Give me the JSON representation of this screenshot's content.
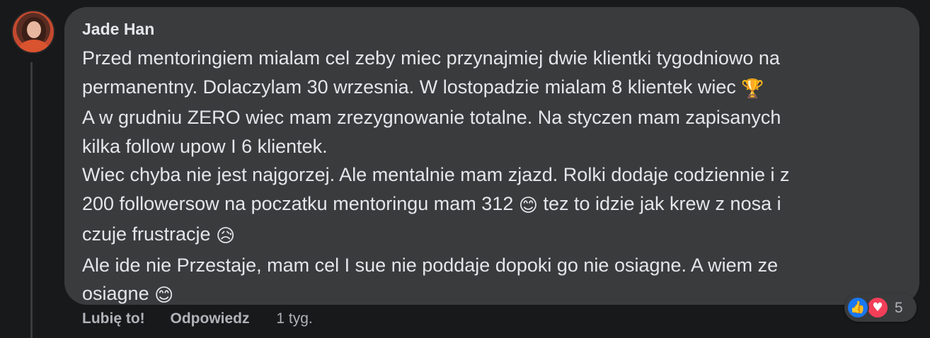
{
  "comment": {
    "author": "Jade Han",
    "lines": [
      {
        "text": "Przed mentoringiem mialam cel zeby miec przynajmiej dwie klientki tygodniowo na",
        "emoji": ""
      },
      {
        "text": "permanentny. Dolaczylam 30 wrzesnia. W lostopadzie mialam 8 klientek wiec ",
        "emoji": "🏆"
      },
      {
        "text": "A w grudniu ZERO wiec mam zrezygnowanie totalne. Na styczen mam zapisanych",
        "emoji": ""
      },
      {
        "text": "kilka follow upow I 6 klientek.",
        "emoji": ""
      },
      {
        "text": "Wiec chyba nie jest najgorzej. Ale mentalnie mam zjazd. Rolki dodaje codziennie i z",
        "emoji": ""
      },
      {
        "text": "200 followersow na poczatku mentoringu mam 312 ",
        "emoji": "😊",
        "after": " tez to idzie jak krew z nosa i"
      },
      {
        "text": "czuje frustracje ",
        "emoji": "😥"
      },
      {
        "text": "Ale ide nie Przestaje, mam cel I sue nie poddaje dopoki go nie osiagne. A wiem ze",
        "emoji": ""
      },
      {
        "text": "osiagne ",
        "emoji": "😊"
      }
    ]
  },
  "actions": {
    "like_label": "Lubię to!",
    "reply_label": "Odpowiedz",
    "timestamp": "1 tyg."
  },
  "reactions": {
    "like_icon": "👍",
    "love_icon": "♥",
    "count": "5"
  },
  "colors": {
    "background": "#18191a",
    "bubble": "#3a3b3c",
    "text": "#e4e6eb",
    "secondary_text": "#b0b3b8",
    "like_blue": "#1877f2",
    "love_red": "#f33e58"
  }
}
